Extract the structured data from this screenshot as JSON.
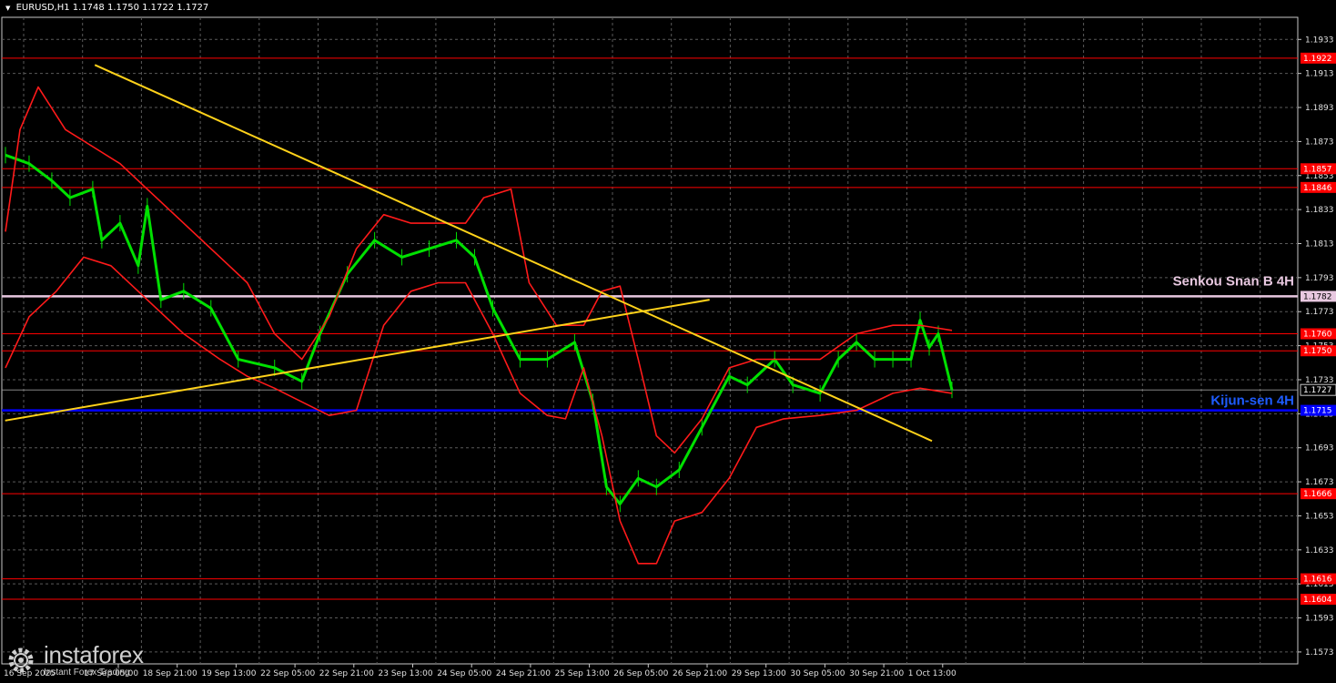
{
  "header": {
    "symbol": "EURUSD,H1",
    "ohlc": "1.1748 1.1750 1.1722 1.1727"
  },
  "watermark": {
    "brand": "instaforex",
    "tagline": "Instant Forex Trading",
    "icon": "gear-icon"
  },
  "chart_data": {
    "type": "candlestick",
    "timeframe": "H1",
    "ylim": [
      1.1566,
      1.1946
    ],
    "grid": true,
    "y_ticks": [
      1.1933,
      1.1913,
      1.1893,
      1.1873,
      1.1853,
      1.1833,
      1.1813,
      1.1793,
      1.1773,
      1.1753,
      1.1733,
      1.1713,
      1.1693,
      1.1673,
      1.1653,
      1.1633,
      1.1613,
      1.1593,
      1.1573
    ],
    "x_ticks": [
      "16 Sep 2025",
      "17 Sep 05:00",
      "18 Sep 21:00",
      "19 Sep 13:00",
      "22 Sep 05:00",
      "22 Sep 21:00",
      "23 Sep 13:00",
      "24 Sep 05:00",
      "24 Sep 21:00",
      "25 Sep 13:00",
      "26 Sep 05:00",
      "26 Sep 21:00",
      "29 Sep 13:00",
      "30 Sep 05:00",
      "30 Sep 21:00",
      "1 Oct 13:00"
    ],
    "current_price": "1.1727",
    "levels": [
      {
        "price": 1.1922,
        "label": "1.1922",
        "color": "#ff0000"
      },
      {
        "price": 1.1857,
        "label": "1.1857",
        "color": "#ff0000"
      },
      {
        "price": 1.1846,
        "label": "1.1846",
        "color": "#ff0000"
      },
      {
        "price": 1.1782,
        "label": "1.1782",
        "color": "#e8c8e0",
        "name": "Senkou Snan B 4H"
      },
      {
        "price": 1.176,
        "label": "1.1760",
        "color": "#ff0000"
      },
      {
        "price": 1.175,
        "label": "1.1750",
        "color": "#ff0000"
      },
      {
        "price": 1.1715,
        "label": "1.1715",
        "color": "#0000ff",
        "name": "Kijun-sen 4H"
      },
      {
        "price": 1.1666,
        "label": "1.1666",
        "color": "#ff0000"
      },
      {
        "price": 1.1616,
        "label": "1.1616",
        "color": "#ff0000"
      },
      {
        "price": 1.1604,
        "label": "1.1604",
        "color": "#ff0000"
      }
    ],
    "trendlines": [
      {
        "from": [
          0.098,
          1.1918
        ],
        "to": [
          0.975,
          1.1697
        ],
        "color": "#ffd21a"
      },
      {
        "from": [
          0.004,
          1.1709
        ],
        "to": [
          0.742,
          1.178
        ],
        "color": "#ffd21a"
      }
    ],
    "series": [
      {
        "name": "close",
        "type": "price",
        "color": "#00e000",
        "x": [
          0.004,
          0.03,
          0.055,
          0.075,
          0.1,
          0.11,
          0.13,
          0.15,
          0.16,
          0.175,
          0.2,
          0.23,
          0.26,
          0.3,
          0.33,
          0.35,
          0.38,
          0.41,
          0.44,
          0.47,
          0.5,
          0.52,
          0.54,
          0.57,
          0.6,
          0.63,
          0.65,
          0.665,
          0.68,
          0.7,
          0.72,
          0.745,
          0.77,
          0.8,
          0.82,
          0.85,
          0.87,
          0.9,
          0.92,
          0.94,
          0.96,
          0.98,
          1.0,
          1.01,
          1.02,
          1.03,
          1.045
        ],
        "y": [
          1.1865,
          1.186,
          1.185,
          1.184,
          1.1845,
          1.1815,
          1.1825,
          1.18,
          1.1835,
          1.178,
          1.1785,
          1.1775,
          1.1745,
          1.174,
          1.1732,
          1.176,
          1.1795,
          1.1815,
          1.1805,
          1.181,
          1.1815,
          1.1805,
          1.1775,
          1.1745,
          1.1745,
          1.1755,
          1.172,
          1.167,
          1.166,
          1.1675,
          1.167,
          1.168,
          1.1705,
          1.1735,
          1.173,
          1.1745,
          1.173,
          1.1725,
          1.1745,
          1.1755,
          1.1745,
          1.1745,
          1.1745,
          1.1768,
          1.1752,
          1.176,
          1.1727
        ]
      },
      {
        "name": "bb_upper",
        "type": "indicator",
        "color": "#ff1a1a",
        "x": [
          0.004,
          0.02,
          0.04,
          0.07,
          0.1,
          0.13,
          0.16,
          0.2,
          0.24,
          0.27,
          0.3,
          0.33,
          0.36,
          0.39,
          0.42,
          0.45,
          0.48,
          0.51,
          0.53,
          0.56,
          0.58,
          0.61,
          0.64,
          0.66,
          0.68,
          0.7,
          0.72,
          0.74,
          0.77,
          0.8,
          0.83,
          0.86,
          0.9,
          0.94,
          0.98,
          1.01,
          1.045
        ],
        "y": [
          1.182,
          1.188,
          1.1905,
          1.188,
          1.187,
          1.186,
          1.1845,
          1.1825,
          1.1805,
          1.179,
          1.176,
          1.1745,
          1.177,
          1.181,
          1.183,
          1.1825,
          1.1825,
          1.1825,
          1.184,
          1.1845,
          1.179,
          1.1765,
          1.1765,
          1.1785,
          1.1788,
          1.1745,
          1.17,
          1.169,
          1.171,
          1.174,
          1.1745,
          1.1745,
          1.1745,
          1.176,
          1.1765,
          1.1765,
          1.1762
        ]
      },
      {
        "name": "bb_lower",
        "type": "indicator",
        "color": "#ff1a1a",
        "x": [
          0.004,
          0.03,
          0.06,
          0.09,
          0.12,
          0.16,
          0.2,
          0.24,
          0.27,
          0.3,
          0.33,
          0.36,
          0.39,
          0.42,
          0.45,
          0.48,
          0.51,
          0.54,
          0.57,
          0.6,
          0.62,
          0.64,
          0.66,
          0.68,
          0.7,
          0.72,
          0.74,
          0.77,
          0.8,
          0.83,
          0.86,
          0.9,
          0.94,
          0.98,
          1.01,
          1.045
        ],
        "y": [
          1.174,
          1.177,
          1.1785,
          1.1805,
          1.18,
          1.178,
          1.176,
          1.1745,
          1.1735,
          1.1728,
          1.172,
          1.1712,
          1.1715,
          1.1765,
          1.1785,
          1.179,
          1.179,
          1.176,
          1.1725,
          1.1712,
          1.171,
          1.174,
          1.17,
          1.165,
          1.1625,
          1.1625,
          1.165,
          1.1655,
          1.1675,
          1.1705,
          1.171,
          1.1712,
          1.1715,
          1.1725,
          1.1728,
          1.1725
        ]
      }
    ]
  }
}
